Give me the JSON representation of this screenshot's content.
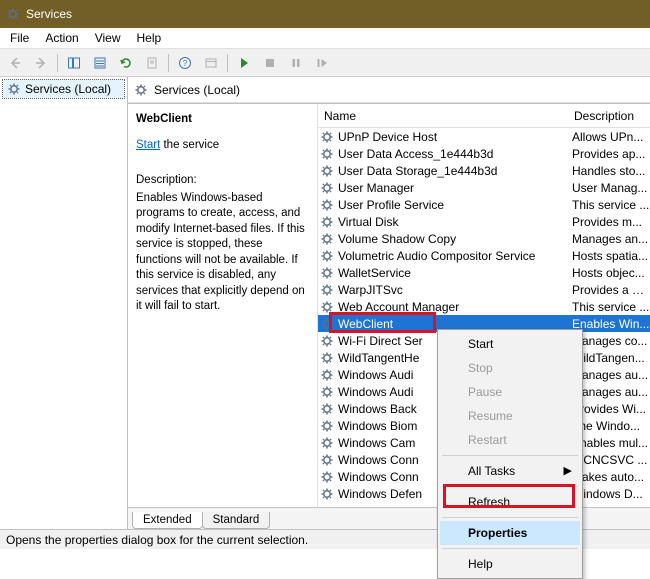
{
  "window": {
    "title": "Services"
  },
  "menu": {
    "file": "File",
    "action": "Action",
    "view": "View",
    "help": "Help"
  },
  "left": {
    "root": "Services (Local)"
  },
  "pane": {
    "header": "Services (Local)"
  },
  "details": {
    "name": "WebClient",
    "start_label": "Start",
    "start_rest": " the service",
    "desc_label": "Description:",
    "desc_text": "Enables Windows-based programs to create, access, and modify Internet-based files. If this service is stopped, these functions will not be available. If this service is disabled, any services that explicitly depend on it will fail to start."
  },
  "columns": {
    "name": "Name",
    "desc": "Description"
  },
  "rows": [
    {
      "name": "UPnP Device Host",
      "desc": "Allows UPn..."
    },
    {
      "name": "User Data Access_1e444b3d",
      "desc": "Provides ap..."
    },
    {
      "name": "User Data Storage_1e444b3d",
      "desc": "Handles sto..."
    },
    {
      "name": "User Manager",
      "desc": "User Manag..."
    },
    {
      "name": "User Profile Service",
      "desc": "This service ..."
    },
    {
      "name": "Virtual Disk",
      "desc": "Provides m..."
    },
    {
      "name": "Volume Shadow Copy",
      "desc": "Manages an..."
    },
    {
      "name": "Volumetric Audio Compositor Service",
      "desc": "Hosts spatia..."
    },
    {
      "name": "WalletService",
      "desc": "Hosts objec..."
    },
    {
      "name": "WarpJITSvc",
      "desc": "Provides a JI..."
    },
    {
      "name": "Web Account Manager",
      "desc": "This service ..."
    },
    {
      "name": "WebClient",
      "desc": "Enables Win..."
    },
    {
      "name": "Wi-Fi Direct Ser",
      "desc": "Manages co..."
    },
    {
      "name": "WildTangentHe",
      "desc": "WildTangen..."
    },
    {
      "name": "Windows Audi",
      "desc": "Manages au..."
    },
    {
      "name": "Windows Audi",
      "desc": "Manages au..."
    },
    {
      "name": "Windows Back",
      "desc": "Provides Wi..."
    },
    {
      "name": "Windows Biom",
      "desc": "The Windo..."
    },
    {
      "name": "Windows Cam",
      "desc": "Enables mul..."
    },
    {
      "name": "Windows Conn",
      "desc": "WCNCSVC ..."
    },
    {
      "name": "Windows Conn",
      "desc": "Makes auto..."
    },
    {
      "name": "Windows Defen",
      "desc": "Windows D..."
    }
  ],
  "selected_index": 11,
  "tabs": {
    "extended": "Extended",
    "standard": "Standard"
  },
  "context_menu": {
    "start": "Start",
    "stop": "Stop",
    "pause": "Pause",
    "resume": "Resume",
    "restart": "Restart",
    "all_tasks": "All Tasks",
    "refresh": "Refresh",
    "properties": "Properties",
    "help": "Help"
  },
  "status": "Opens the properties dialog box for the current selection."
}
